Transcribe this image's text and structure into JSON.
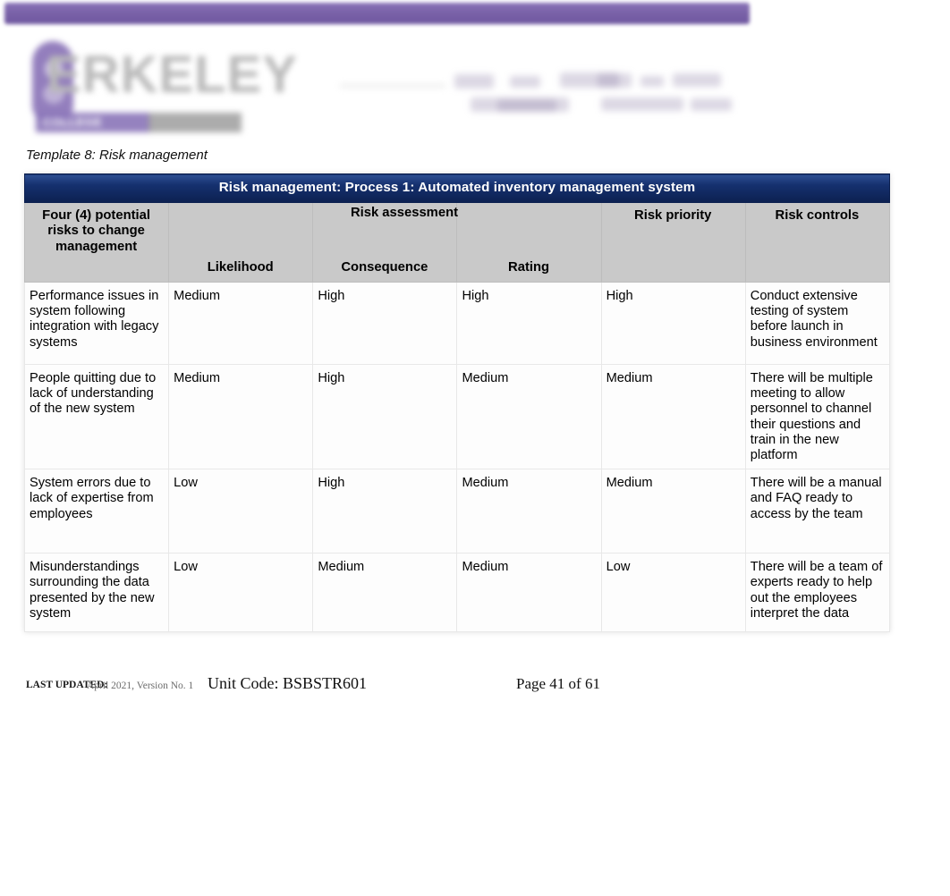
{
  "header": {
    "accent_bar_color": "#7a62a8",
    "logo_word": "ERKELEY",
    "logo_tagline": "COLLEGE",
    "logo_mark": "b-monogram-icon"
  },
  "caption": "Template 8: Risk management",
  "table": {
    "title": "Risk management: Process 1: Automated inventory management system",
    "group_headers": {
      "risks": "Four (4) potential risks to change management",
      "assessment": "Risk assessment",
      "priority": "Risk priority",
      "controls": "Risk controls"
    },
    "sub_headers": {
      "likelihood": "Likelihood",
      "consequence": "Consequence",
      "rating": "Rating"
    },
    "rows": [
      {
        "risk": "Performance issues in system following integration with legacy systems",
        "likelihood": "Medium",
        "consequence": "High",
        "rating": "High",
        "priority": "High",
        "controls": "Conduct extensive testing of system before launch in business environment"
      },
      {
        "risk": "People quitting due to lack of understanding of the new system",
        "likelihood": "Medium",
        "consequence": "High",
        "rating": "Medium",
        "priority": "Medium",
        "controls": "There will be multiple meeting to allow personnel to channel their questions and train in the new platform"
      },
      {
        "risk": "System errors due to lack of expertise from employees",
        "likelihood": "Low",
        "consequence": "High",
        "rating": "Medium",
        "priority": "Medium",
        "controls": "There will be a manual and FAQ ready to access by the team"
      },
      {
        "risk": "Misunderstandings surrounding the data presented by the new system",
        "likelihood": "Low",
        "consequence": "Medium",
        "rating": "Medium",
        "priority": "Low",
        "controls": "There will be a team of experts ready to help out the employees interpret the data"
      }
    ]
  },
  "footer": {
    "last_updated_label": "LAST UPDATED:",
    "last_updated_value": "April 2021, Version No. 1",
    "unit_code": "Unit Code: BSBSTR601",
    "page": "Page 41 of 61"
  }
}
